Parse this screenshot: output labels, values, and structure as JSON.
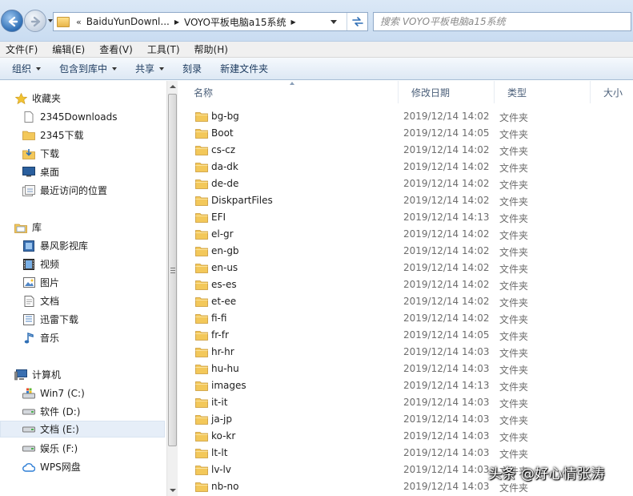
{
  "address": {
    "breadcrumb_lead": "«",
    "crumbs": [
      "BaiduYunDownl...",
      "VOYO平板电脑a15系统"
    ],
    "search_placeholder": "搜索 VOYO平板电脑a15系统"
  },
  "menubar": {
    "items": [
      "文件(F)",
      "编辑(E)",
      "查看(V)",
      "工具(T)",
      "帮助(H)"
    ]
  },
  "toolbar": {
    "organize": "组织",
    "include_library": "包含到库中",
    "share": "共享",
    "burn": "刻录",
    "new_folder": "新建文件夹"
  },
  "navpane": {
    "favorites": {
      "label": "收藏夹",
      "items": [
        "2345Downloads",
        "2345下载",
        "下载",
        "桌面",
        "最近访问的位置"
      ]
    },
    "libraries": {
      "label": "库",
      "items": [
        "暴风影视库",
        "视频",
        "图片",
        "文档",
        "迅雷下载",
        "音乐"
      ]
    },
    "computer": {
      "label": "计算机",
      "items": [
        "Win7 (C:)",
        "软件 (D:)",
        "文档 (E:)",
        "娱乐 (F:)",
        "WPS网盘"
      ],
      "selected": "文档 (E:)"
    }
  },
  "columns": {
    "name": "名称",
    "date": "修改日期",
    "type": "类型",
    "size": "大小"
  },
  "files": [
    {
      "name": "bg-bg",
      "date": "2019/12/14 14:02",
      "type": "文件夹"
    },
    {
      "name": "Boot",
      "date": "2019/12/14 14:05",
      "type": "文件夹"
    },
    {
      "name": "cs-cz",
      "date": "2019/12/14 14:02",
      "type": "文件夹"
    },
    {
      "name": "da-dk",
      "date": "2019/12/14 14:02",
      "type": "文件夹"
    },
    {
      "name": "de-de",
      "date": "2019/12/14 14:02",
      "type": "文件夹"
    },
    {
      "name": "DiskpartFiles",
      "date": "2019/12/14 14:02",
      "type": "文件夹"
    },
    {
      "name": "EFI",
      "date": "2019/12/14 14:13",
      "type": "文件夹"
    },
    {
      "name": "el-gr",
      "date": "2019/12/14 14:02",
      "type": "文件夹"
    },
    {
      "name": "en-gb",
      "date": "2019/12/14 14:02",
      "type": "文件夹"
    },
    {
      "name": "en-us",
      "date": "2019/12/14 14:02",
      "type": "文件夹"
    },
    {
      "name": "es-es",
      "date": "2019/12/14 14:02",
      "type": "文件夹"
    },
    {
      "name": "et-ee",
      "date": "2019/12/14 14:02",
      "type": "文件夹"
    },
    {
      "name": "fi-fi",
      "date": "2019/12/14 14:02",
      "type": "文件夹"
    },
    {
      "name": "fr-fr",
      "date": "2019/12/14 14:05",
      "type": "文件夹"
    },
    {
      "name": "hr-hr",
      "date": "2019/12/14 14:03",
      "type": "文件夹"
    },
    {
      "name": "hu-hu",
      "date": "2019/12/14 14:03",
      "type": "文件夹"
    },
    {
      "name": "images",
      "date": "2019/12/14 14:13",
      "type": "文件夹"
    },
    {
      "name": "it-it",
      "date": "2019/12/14 14:03",
      "type": "文件夹"
    },
    {
      "name": "ja-jp",
      "date": "2019/12/14 14:03",
      "type": "文件夹"
    },
    {
      "name": "ko-kr",
      "date": "2019/12/14 14:03",
      "type": "文件夹"
    },
    {
      "name": "lt-lt",
      "date": "2019/12/14 14:03",
      "type": "文件夹"
    },
    {
      "name": "lv-lv",
      "date": "2019/12/14 14:03",
      "type": "文件夹"
    },
    {
      "name": "nb-no",
      "date": "2019/12/14 14:03",
      "type": "文件夹"
    }
  ],
  "watermark": "头条 @好心情张涛",
  "colors": {
    "accent": "#2f6fb5",
    "folder": "#e8b54a",
    "toolbar_text": "#1e3c60",
    "header_text": "#4c607a",
    "secondary_text": "#6d6d6d"
  }
}
